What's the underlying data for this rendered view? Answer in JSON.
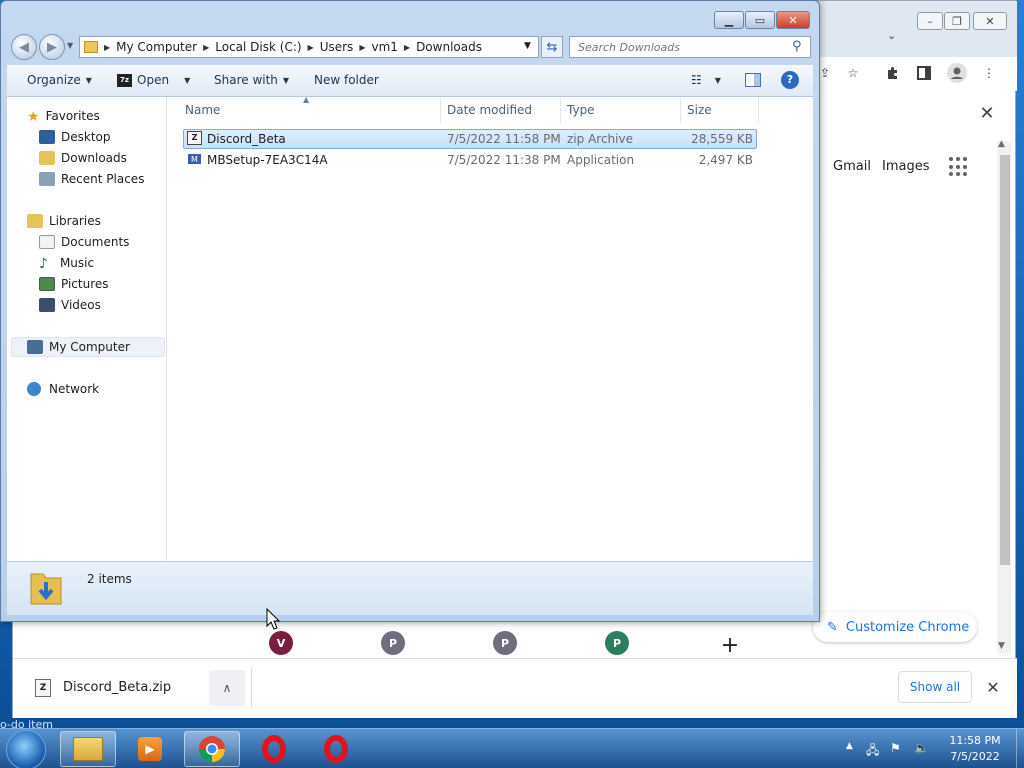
{
  "chrome": {
    "window_controls": {
      "min": "–",
      "max": "❐",
      "close": "✕"
    },
    "links": {
      "gmail": "Gmail",
      "images": "Images"
    },
    "customize_label": "Customize Chrome",
    "shortcuts": [
      {
        "letter": "V",
        "color": "#7a1e3f"
      },
      {
        "letter": "P",
        "color": "#6e6e7e"
      },
      {
        "letter": "P",
        "color": "#6e6e7e"
      },
      {
        "letter": "P",
        "color": "#2f7d5e"
      }
    ],
    "add_shortcut": "+",
    "download_bar": {
      "file_name": "Discord_Beta.zip",
      "show_all": "Show all",
      "close": "✕",
      "menu": "∧"
    }
  },
  "explorer": {
    "window_controls": {
      "min": "▁",
      "max": "▭",
      "close": "✕"
    },
    "breadcrumb": [
      "My Computer",
      "Local Disk (C:)",
      "Users",
      "vm1",
      "Downloads"
    ],
    "search_placeholder": "Search Downloads",
    "commands": {
      "organize": "Organize",
      "open": "Open",
      "share_with": "Share with",
      "new_folder": "New folder"
    },
    "nav": {
      "favorites": "Favorites",
      "desktop": "Desktop",
      "downloads": "Downloads",
      "recent_places": "Recent Places",
      "libraries": "Libraries",
      "documents": "Documents",
      "music": "Music",
      "pictures": "Pictures",
      "videos": "Videos",
      "my_computer": "My Computer",
      "network": "Network"
    },
    "columns": {
      "name": "Name",
      "date_modified": "Date modified",
      "type": "Type",
      "size": "Size"
    },
    "files": [
      {
        "name": "Discord_Beta",
        "date": "7/5/2022 11:58 PM",
        "type": "zip Archive",
        "size": "28,559 KB"
      },
      {
        "name": "MBSetup-7EA3C14A",
        "date": "7/5/2022 11:38 PM",
        "type": "Application",
        "size": "2,497 KB"
      }
    ],
    "status_count": "2 items"
  },
  "desktop_hint": "o-do item",
  "taskbar": {
    "clock_time": "11:58 PM",
    "clock_date": "7/5/2022"
  }
}
